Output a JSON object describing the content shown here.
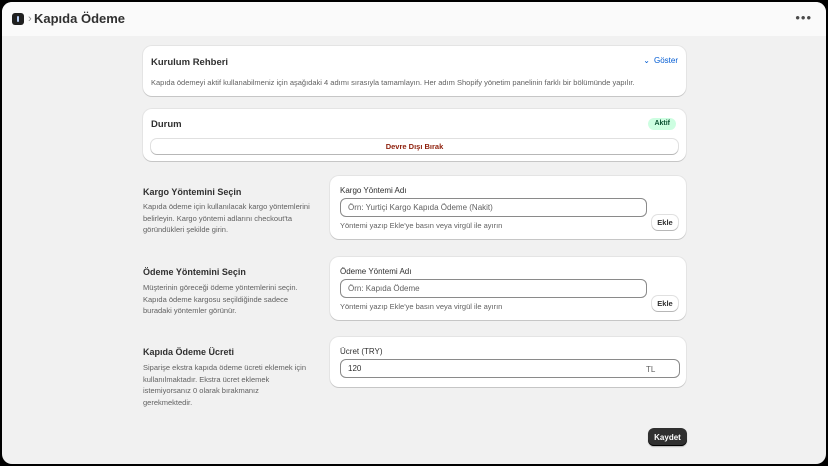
{
  "header": {
    "separator": "›",
    "title": "Kapıda Ödeme",
    "more_label": "•••"
  },
  "guide": {
    "title": "Kurulum Rehberi",
    "toggle_label": "Göster",
    "description": "Kapıda ödemeyi aktif kullanabilmeniz için aşağıdaki 4 adımı sırasıyla tamamlayın. Her adım Shopify yönetim panelinin farklı bir bölümünde yapılır."
  },
  "status": {
    "title": "Durum",
    "badge": "Aktif",
    "badge_color": "#cdfee1",
    "disable_label": "Devre Dışı Bırak",
    "disable_color": "#8e1f0b"
  },
  "shipping": {
    "section_title": "Kargo Yöntemini Seçin",
    "description": "Kapıda ödeme için kullanılacak kargo yöntemlerini belirleyin. Kargo yöntemi adlarını checkout'ta göründükleri şekilde girin.",
    "field_label": "Kargo Yöntemi Adı",
    "placeholder": "Örn: Yurtiçi Kargo Kapıda Ödeme (Nakit)",
    "help": "Yöntemi yazıp Ekle'ye basın veya virgül ile ayırın",
    "add_label": "Ekle"
  },
  "payment": {
    "section_title": "Ödeme Yöntemini Seçin",
    "description": "Müşterinin göreceği ödeme yöntemlerini seçin. Kapıda ödeme kargosu seçildiğinde sadece buradaki yöntemler görünür.",
    "field_label": "Ödeme Yöntemi Adı",
    "placeholder": "Örn: Kapıda Ödeme",
    "help": "Yöntemi yazıp Ekle'ye basın veya virgül ile ayırın",
    "add_label": "Ekle"
  },
  "fee": {
    "section_title": "Kapıda Ödeme Ücreti",
    "description": "Siparişe ekstra kapıda ödeme ücreti eklemek için kullanılmaktadır. Ekstra ücret eklemek istemiyorsanız 0 olarak bırakmanız gerekmektedir.",
    "field_label": "Ücret (TRY)",
    "value": "120",
    "suffix": "TL"
  },
  "footer": {
    "save_label": "Kaydet"
  }
}
